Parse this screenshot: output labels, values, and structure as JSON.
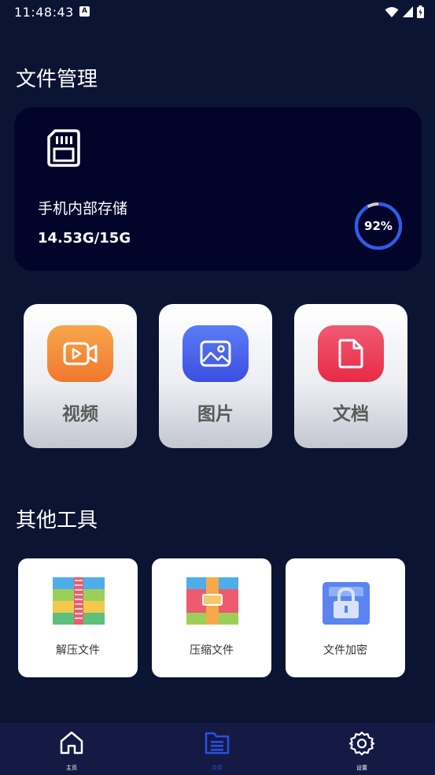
{
  "status_bar": {
    "time": "11:48:43",
    "notification_icon": "a-icon",
    "icons": [
      "wifi-icon",
      "signal-icon",
      "battery-icon"
    ]
  },
  "file_manager": {
    "title": "文件管理",
    "storage": {
      "name": "手机内部存储",
      "size": "14.53G/15G",
      "percent_label": "92%",
      "percent_value": 92,
      "icon": "sd-card-icon"
    }
  },
  "categories": [
    {
      "label": "视频",
      "icon": "video-icon",
      "color_top": "#f7a64c",
      "color_bottom": "#f0782d"
    },
    {
      "label": "图片",
      "icon": "image-icon",
      "color_top": "#5a7df7",
      "color_bottom": "#3d4ee0"
    },
    {
      "label": "文档",
      "icon": "document-icon",
      "color_top": "#f05a74",
      "color_bottom": "#e82b45"
    }
  ],
  "other_tools": {
    "title": "其他工具",
    "items": [
      {
        "label": "解压文件",
        "icon": "unzip-archive-icon"
      },
      {
        "label": "压缩文件",
        "icon": "compress-archive-icon"
      },
      {
        "label": "文件加密",
        "icon": "lock-folder-icon"
      }
    ]
  },
  "bottom_nav": [
    {
      "label": "主页",
      "icon": "home-icon",
      "active": false
    },
    {
      "label": "文件",
      "icon": "files-icon",
      "active": true
    },
    {
      "label": "设置",
      "icon": "gear-icon",
      "active": false
    }
  ],
  "colors": {
    "background": "#0b1432",
    "card": "#03042a",
    "ring": "#2b5bf0",
    "nav_active": "#2b4fe6"
  }
}
